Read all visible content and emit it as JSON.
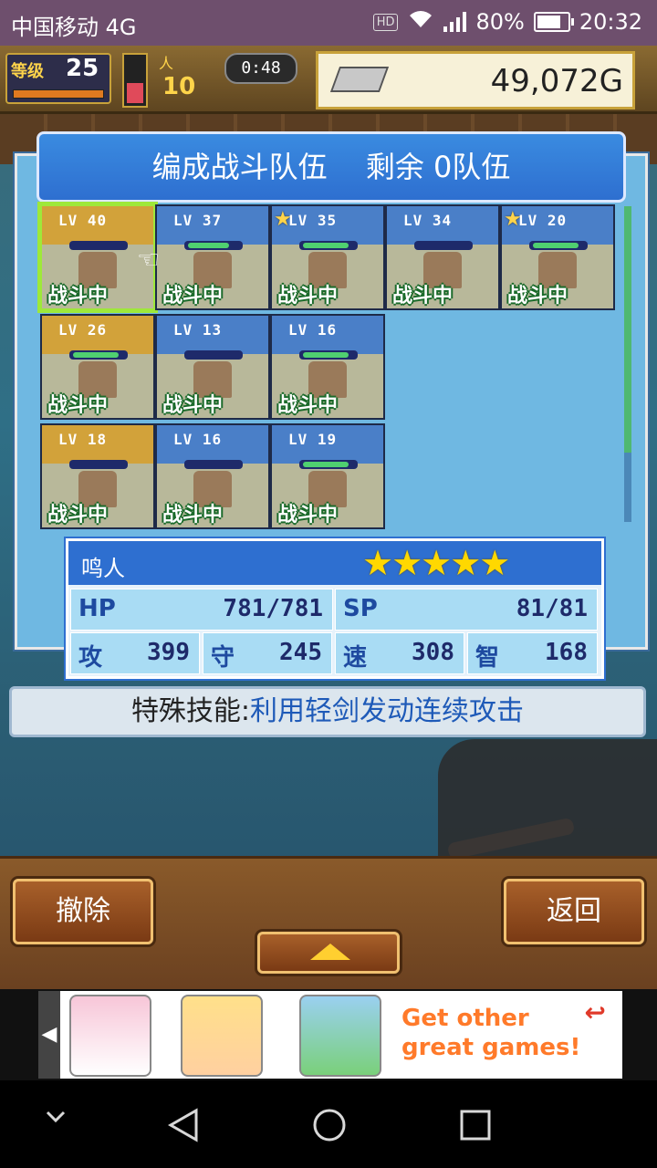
{
  "status_bar": {
    "carrier": "中国移动 4G",
    "hd": "HD",
    "net": "4G",
    "battery": "80%",
    "time": "20:32"
  },
  "hud": {
    "level_label": "等级",
    "level": "25",
    "crew_label": "人",
    "crew_count": "10",
    "timer": "0:48",
    "gold": "49,072G"
  },
  "dialog": {
    "title": "编成战斗队伍　 剩余 0队伍"
  },
  "cards": [
    {
      "lv": "LV 40",
      "status": "战斗中",
      "star": false,
      "gold": true,
      "hp": 0.0,
      "selected": true
    },
    {
      "lv": "LV 37",
      "status": "战斗中",
      "star": false,
      "gold": false,
      "hp": 0.8
    },
    {
      "lv": "LV 35",
      "status": "战斗中",
      "star": true,
      "gold": false,
      "hp": 0.9
    },
    {
      "lv": "LV 34",
      "status": "战斗中",
      "star": false,
      "gold": false,
      "hp": 0.0
    },
    {
      "lv": "LV 20",
      "status": "战斗中",
      "star": true,
      "gold": false,
      "hp": 0.9
    },
    {
      "lv": "LV 26",
      "status": "战斗中",
      "star": false,
      "gold": true,
      "hp": 0.9
    },
    {
      "lv": "LV 13",
      "status": "战斗中",
      "star": false,
      "gold": false,
      "hp": 0.0
    },
    {
      "lv": "LV 16",
      "status": "战斗中",
      "star": false,
      "gold": false,
      "hp": 0.9
    },
    {
      "lv": "LV 18",
      "status": "战斗中",
      "star": false,
      "gold": true,
      "hp": 0.0
    },
    {
      "lv": "LV 16",
      "status": "战斗中",
      "star": false,
      "gold": false,
      "hp": 0.0
    },
    {
      "lv": "LV 19",
      "status": "战斗中",
      "star": false,
      "gold": false,
      "hp": 0.9
    }
  ],
  "selected_char": {
    "name": "鸣人",
    "stars": "★★★★★",
    "hp_label": "HP",
    "hp": "781/781",
    "sp_label": "SP",
    "sp": "81/81",
    "atk_label": "攻",
    "atk": "399",
    "def_label": "守",
    "def": "245",
    "spd_label": "速",
    "spd": "308",
    "int_label": "智",
    "int": "168"
  },
  "skill": {
    "label": "特殊技能:",
    "value": "利用轻剑发动连续攻击"
  },
  "buttons": {
    "remove": "撤除",
    "back": "返回"
  },
  "ad": {
    "left_arrow": "◀",
    "text_line1": "Get other",
    "text_line2": "great games!",
    "return_icon": "↩"
  },
  "colors": {
    "title_blue": "#2e6fd0",
    "panel_blue": "#6fb8e2",
    "select_green": "#9ee83a",
    "skill_text": "#1e5ab8"
  }
}
